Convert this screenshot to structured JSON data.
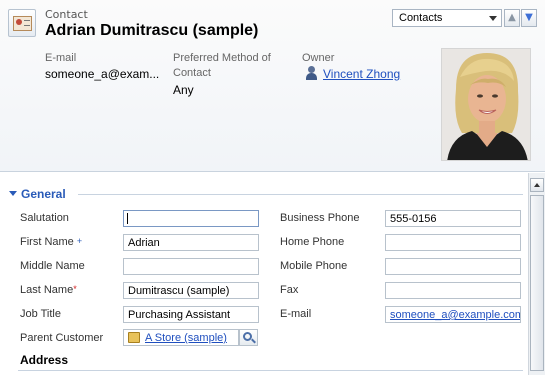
{
  "header": {
    "entity_type": "Contact",
    "title": "Adrian Dumitrascu (sample)",
    "nav_select_value": "Contacts",
    "nav_up_icon": "arrow-up-icon",
    "nav_down_icon": "arrow-down-icon",
    "fields": {
      "email_label": "E-mail",
      "email_value": "someone_a@exam...",
      "preferred_label_line1": "Preferred Method of",
      "preferred_label_line2": "Contact",
      "preferred_value": "Any",
      "owner_label": "Owner",
      "owner_value": "Vincent Zhong"
    }
  },
  "section": {
    "title": "General",
    "left_fields": [
      {
        "label": "Salutation",
        "value": "",
        "marker": ""
      },
      {
        "label": "First Name",
        "value": "Adrian",
        "marker": "+"
      },
      {
        "label": "Middle Name",
        "value": "",
        "marker": ""
      },
      {
        "label": "Last Name",
        "value": "Dumitrascu (sample)",
        "marker": "*"
      },
      {
        "label": "Job Title",
        "value": "Purchasing Assistant",
        "marker": ""
      },
      {
        "label": "Parent Customer",
        "value": "A Store (sample)",
        "marker": ""
      }
    ],
    "right_fields": [
      {
        "label": "Business Phone",
        "value": "555-0156"
      },
      {
        "label": "Home Phone",
        "value": ""
      },
      {
        "label": "Mobile Phone",
        "value": ""
      },
      {
        "label": "Fax",
        "value": ""
      },
      {
        "label": "E-mail",
        "value": "someone_a@example.com"
      }
    ],
    "subsection_title": "Address"
  },
  "colors": {
    "accent": "#2a5bb8",
    "link": "#1f4fbf",
    "required": "#d21d1d"
  }
}
